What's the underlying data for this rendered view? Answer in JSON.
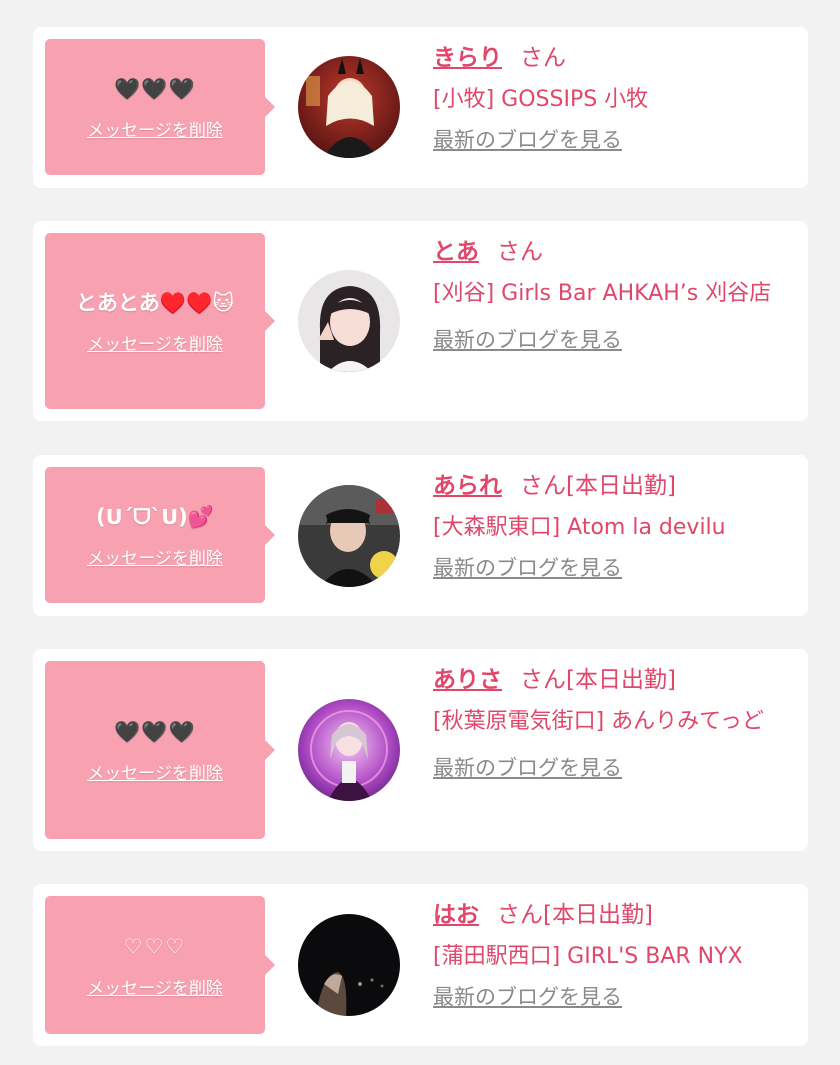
{
  "colors": {
    "page_bg": "#f2f2f2",
    "card_bg": "#ffffff",
    "bubble_bg": "#f7a1b1",
    "accent_pink": "#e0476b",
    "link_gray": "#8a8a8a"
  },
  "cards": [
    {
      "message": "🖤🖤🖤",
      "delete_label": "メッセージを削除",
      "name": "きらり",
      "suffix": "さん",
      "shop": "[小牧] GOSSIPS 小牧",
      "blog_label": "最新のブログを見る"
    },
    {
      "message": "とあとあ♥️♥️🐱",
      "delete_label": "メッセージを削除",
      "name": "とあ",
      "suffix": "さん",
      "shop": "[刈谷] Girls Bar AHKAH’s 刈谷店",
      "blog_label": "最新のブログを見る"
    },
    {
      "message": "(ᑌ´ᗜ`ᑌ)💕",
      "delete_label": "メッセージを削除",
      "name": "あられ",
      "suffix": "さん[本日出勤]",
      "shop": "[大森駅東口] Atom la devilu",
      "blog_label": "最新のブログを見る"
    },
    {
      "message": "🖤🖤🖤",
      "delete_label": "メッセージを削除",
      "name": "ありさ",
      "suffix": "さん[本日出勤]",
      "shop": "[秋葉原電気街口] あんりみてっど",
      "blog_label": "最新のブログを見る"
    },
    {
      "message": "♡♡♡",
      "delete_label": "メッセージを削除",
      "name": "はお",
      "suffix": "さん[本日出勤]",
      "shop": "[蒲田駅西口] GIRL'S BAR NYX",
      "blog_label": "最新のブログを見る"
    }
  ]
}
